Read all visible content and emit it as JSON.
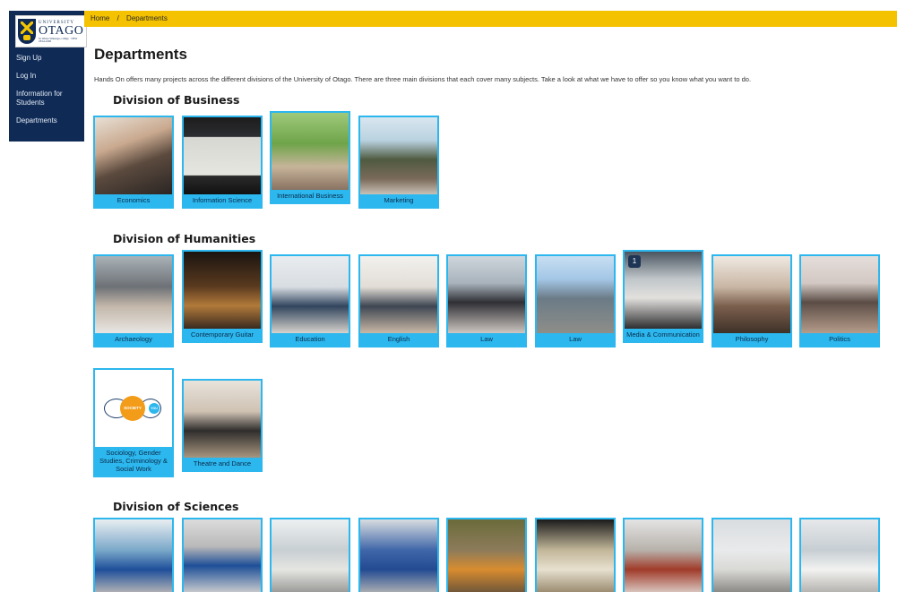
{
  "logo": {
    "top": "UNIVERSITY",
    "main": "OTAGO",
    "sub": "Te Whare Wānanga o Otāgo · NEW ZEALAND"
  },
  "nav": {
    "items": [
      {
        "label": "Sign Up"
      },
      {
        "label": "Log In"
      },
      {
        "label": "Information for Students"
      },
      {
        "label": "Departments"
      }
    ]
  },
  "breadcrumb": {
    "home": "Home",
    "separator": "/",
    "current": "Departments"
  },
  "page": {
    "title": "Departments",
    "intro": "Hands On offers many projects across the different divisions of the University of Otago. There are three main divisions that each cover many subjects. Take a look at what we have to offer so you know what you want to do."
  },
  "colors": {
    "sidebar": "#0e2a55",
    "breadcrumb_bar": "#f4c200",
    "card_accent": "#2cb7ee"
  },
  "divisions": [
    {
      "title": "Division of Business",
      "departments": [
        {
          "label": "Economics"
        },
        {
          "label": "Information Science"
        },
        {
          "label": "International Business"
        },
        {
          "label": "Marketing"
        }
      ]
    },
    {
      "title": "Division of Humanities",
      "departments": [
        {
          "label": "Archaeology"
        },
        {
          "label": "Contemporary Guitar"
        },
        {
          "label": "Education"
        },
        {
          "label": "English"
        },
        {
          "label": "Law"
        },
        {
          "label": "Law"
        },
        {
          "label": "Media & Communication"
        },
        {
          "label": "Philosophy"
        },
        {
          "label": "Politics"
        },
        {
          "label": "Sociology, Gender Studies, Criminology & Social Work",
          "logo_text_a": "SOCIETY",
          "logo_text_b": "YOU"
        },
        {
          "label": "Theatre and Dance"
        }
      ]
    },
    {
      "title": "Division of Sciences",
      "departments": [
        {
          "label": ""
        },
        {
          "label": ""
        },
        {
          "label": ""
        },
        {
          "label": ""
        },
        {
          "label": ""
        },
        {
          "label": ""
        },
        {
          "label": ""
        },
        {
          "label": ""
        },
        {
          "label": ""
        }
      ]
    }
  ],
  "media_badge": "1"
}
